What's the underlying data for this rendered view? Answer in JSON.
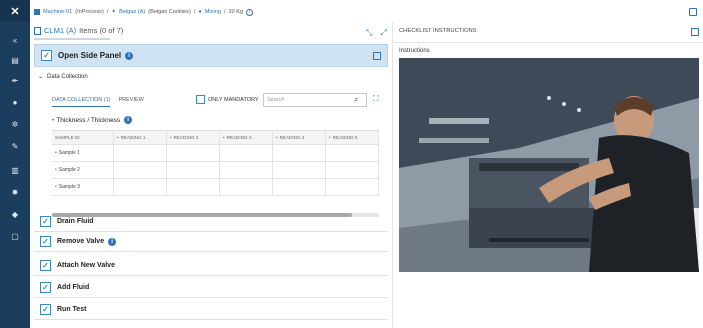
{
  "breadcrumb": {
    "machine": "Machine-01",
    "machine_state": "(InProcess)",
    "product": "Belgas (A)",
    "product_detail": "(Belgas Cookies)",
    "step": "Mixing",
    "weight": "20 Kg"
  },
  "checklist": {
    "name": "CLM1 (A)",
    "items_label": "Items (0 of 7)"
  },
  "open_task": {
    "title": "Open Side Panel"
  },
  "data_collection": {
    "section_label": "Data Collection",
    "tab_active": "DATA COLLECTION (1)",
    "tab_preview": "PREVIEW",
    "only_mandatory": "ONLY MANDATORY",
    "search_placeholder": "Search",
    "parameter": "Thickness / Thickness",
    "columns": [
      "SAMPLE ID",
      "READING 1",
      "READING 2",
      "READING 3",
      "READING 4",
      "READING 5"
    ],
    "rows": [
      "Sample 1",
      "Sample 2",
      "Sample 3"
    ]
  },
  "tasks": [
    {
      "title": "Drain Fluid"
    },
    {
      "title": "Remove Valve"
    },
    {
      "title": "Attach New Valve"
    },
    {
      "title": "Add Fluid"
    },
    {
      "title": "Run Test"
    }
  ],
  "instructions": {
    "header": "CHECKLIST INSTRUCTIONS",
    "label": "Instructions"
  },
  "colors": {
    "nav": "#1b3d5e",
    "accent": "#2e73b8",
    "selected_task": "#cfe3f3",
    "required": "#d93b3b"
  }
}
